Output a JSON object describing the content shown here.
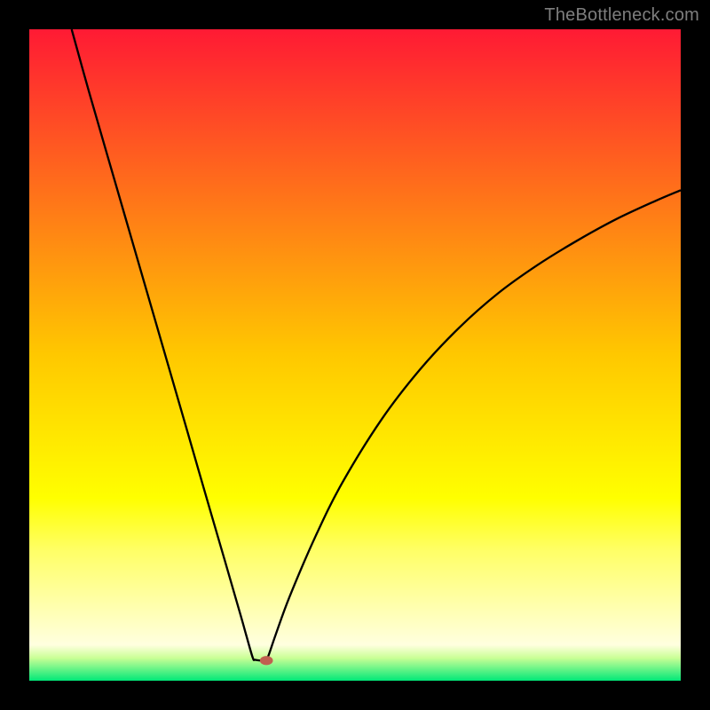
{
  "watermark": "TheBottleneck.com",
  "chart_data": {
    "type": "line",
    "title": "",
    "xlabel": "",
    "ylabel": "",
    "xlim": [
      0,
      100
    ],
    "ylim": [
      0,
      100
    ],
    "background_gradient": {
      "stops": [
        {
          "offset": 0.0,
          "color": "#ff1a34"
        },
        {
          "offset": 0.5,
          "color": "#ffc800"
        },
        {
          "offset": 0.72,
          "color": "#ffff00"
        },
        {
          "offset": 0.8,
          "color": "#ffff66"
        },
        {
          "offset": 0.945,
          "color": "#ffffdf"
        },
        {
          "offset": 0.965,
          "color": "#caff96"
        },
        {
          "offset": 1.0,
          "color": "#00e878"
        }
      ]
    },
    "series": [
      {
        "name": "bottleneck-curve",
        "color": "#000000",
        "points": [
          {
            "x": 6.5,
            "y": 100.0
          },
          {
            "x": 9.0,
            "y": 91.0
          },
          {
            "x": 12.0,
            "y": 80.6
          },
          {
            "x": 16.0,
            "y": 66.8
          },
          {
            "x": 20.0,
            "y": 53.0
          },
          {
            "x": 24.0,
            "y": 39.2
          },
          {
            "x": 27.0,
            "y": 28.8
          },
          {
            "x": 30.0,
            "y": 18.5
          },
          {
            "x": 32.5,
            "y": 9.85
          },
          {
            "x": 33.3,
            "y": 7.0
          },
          {
            "x": 34.3,
            "y": 3.55
          },
          {
            "x": 34.7,
            "y": 3.2
          },
          {
            "x": 36.1,
            "y": 3.1
          },
          {
            "x": 36.6,
            "y": 3.55
          },
          {
            "x": 37.8,
            "y": 7.0
          },
          {
            "x": 40.0,
            "y": 13.0
          },
          {
            "x": 44.0,
            "y": 22.3
          },
          {
            "x": 48.0,
            "y": 30.3
          },
          {
            "x": 54.0,
            "y": 40.0
          },
          {
            "x": 60.0,
            "y": 47.8
          },
          {
            "x": 66.0,
            "y": 54.2
          },
          {
            "x": 72.0,
            "y": 59.5
          },
          {
            "x": 78.0,
            "y": 63.8
          },
          {
            "x": 84.0,
            "y": 67.5
          },
          {
            "x": 90.0,
            "y": 70.8
          },
          {
            "x": 96.0,
            "y": 73.6
          },
          {
            "x": 100.0,
            "y": 75.3
          }
        ]
      }
    ],
    "marker": {
      "x": 36.4,
      "y": 3.1,
      "rx": 1.0,
      "ry": 0.7,
      "color": "#c06050"
    }
  }
}
